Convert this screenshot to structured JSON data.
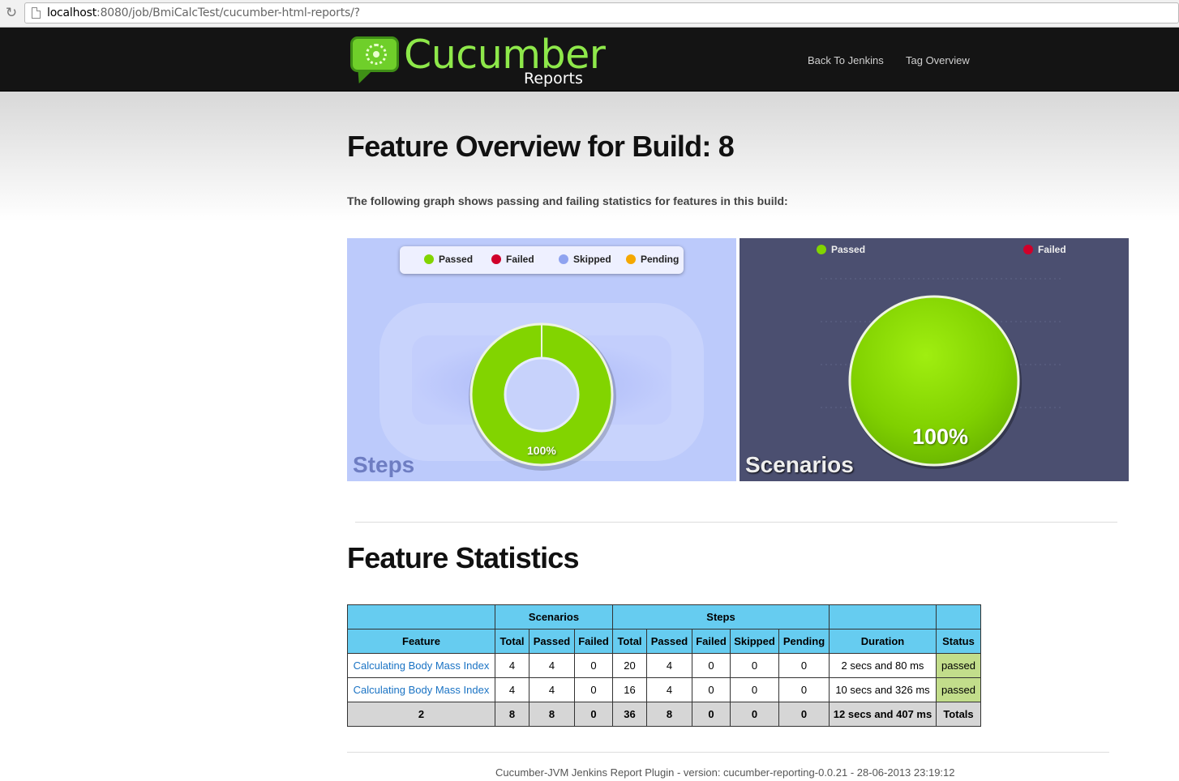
{
  "browser": {
    "url_host": "localhost",
    "url_rest": ":8080/job/BmiCalcTest/cucumber-html-reports/?"
  },
  "header": {
    "logo_title": "Cucumber",
    "logo_subtitle": "Reports",
    "nav": [
      "Back To Jenkins",
      "Tag Overview"
    ]
  },
  "page": {
    "title": "Feature Overview for Build: 8",
    "intro": "The following graph shows passing and failing statistics for features in this build:"
  },
  "colors": {
    "passed": "#82d400",
    "failed": "#d0002a",
    "skipped": "#8fa3f0",
    "pending": "#f5a800",
    "table_header": "#66ccf0",
    "status_passed": "#c2dd8b"
  },
  "chart_data": [
    {
      "type": "pie",
      "style": "donut",
      "title": "Steps",
      "legend": [
        "Passed",
        "Failed",
        "Skipped",
        "Pending"
      ],
      "legend_placement": "top",
      "slices": [
        {
          "name": "Passed",
          "value": 100
        },
        {
          "name": "Failed",
          "value": 0
        },
        {
          "name": "Skipped",
          "value": 0
        },
        {
          "name": "Pending",
          "value": 0
        }
      ],
      "data_label": "100%"
    },
    {
      "type": "pie",
      "title": "Scenarios",
      "legend": [
        "Passed",
        "Failed"
      ],
      "legend_placement": "top",
      "slices": [
        {
          "name": "Passed",
          "value": 100
        },
        {
          "name": "Failed",
          "value": 0
        }
      ],
      "data_label": "100%"
    }
  ],
  "stats": {
    "title": "Feature Statistics",
    "group_headers": {
      "scenarios": "Scenarios",
      "steps": "Steps"
    },
    "columns": [
      "Feature",
      "Total",
      "Passed",
      "Failed",
      "Total",
      "Passed",
      "Failed",
      "Skipped",
      "Pending",
      "Duration",
      "Status"
    ],
    "rows": [
      {
        "feature": "Calculating Body Mass Index",
        "sc_total": "4",
        "sc_passed": "4",
        "sc_failed": "0",
        "st_total": "20",
        "st_passed": "4",
        "st_failed": "0",
        "st_skipped": "0",
        "st_pending": "0",
        "duration": "2 secs and 80 ms",
        "status": "passed"
      },
      {
        "feature": "Calculating Body Mass Index",
        "sc_total": "4",
        "sc_passed": "4",
        "sc_failed": "0",
        "st_total": "16",
        "st_passed": "4",
        "st_failed": "0",
        "st_skipped": "0",
        "st_pending": "0",
        "duration": "10 secs and 326 ms",
        "status": "passed"
      }
    ],
    "totals": {
      "feature": "2",
      "sc_total": "8",
      "sc_passed": "8",
      "sc_failed": "0",
      "st_total": "36",
      "st_passed": "8",
      "st_failed": "0",
      "st_skipped": "0",
      "st_pending": "0",
      "duration": "12 secs and 407 ms",
      "status": "Totals"
    }
  },
  "footer": "Cucumber-JVM Jenkins Report Plugin - version: cucumber-reporting-0.0.21 - 28-06-2013 23:19:12"
}
